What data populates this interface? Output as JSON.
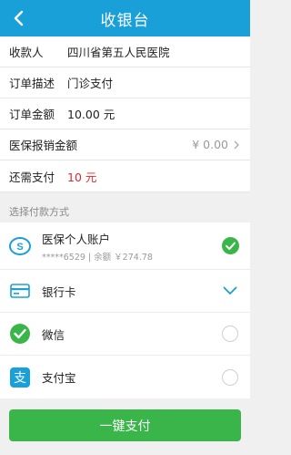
{
  "header": {
    "title": "收银台",
    "back_icon": "chevron-left-icon"
  },
  "info": {
    "payee_label": "收款人",
    "payee_value": "四川省第五人民医院",
    "desc_label": "订单描述",
    "desc_value": "门诊支付",
    "amount_label": "订单金额",
    "amount_value": "10.00 元",
    "insurance_label": "医保报销金额",
    "insurance_value": "¥ 0.00",
    "due_label": "还需支付",
    "due_value": "10 元"
  },
  "section_label": "选择付款方式",
  "methods": [
    {
      "name": "医保个人账户",
      "sub": "*****6529 | 余额 ￥274.78",
      "icon": "social-insurance-icon",
      "state": "selected"
    },
    {
      "name": "银行卡",
      "icon": "bank-card-icon",
      "state": "expand"
    },
    {
      "name": "微信",
      "icon": "wechat-icon",
      "state": "unselected"
    },
    {
      "name": "支付宝",
      "icon": "alipay-icon",
      "state": "unselected"
    }
  ],
  "pay_button": "一键支付",
  "colors": {
    "header": "#1aa0d8",
    "button": "#3ab54a",
    "amount_red": "#e5252b"
  }
}
